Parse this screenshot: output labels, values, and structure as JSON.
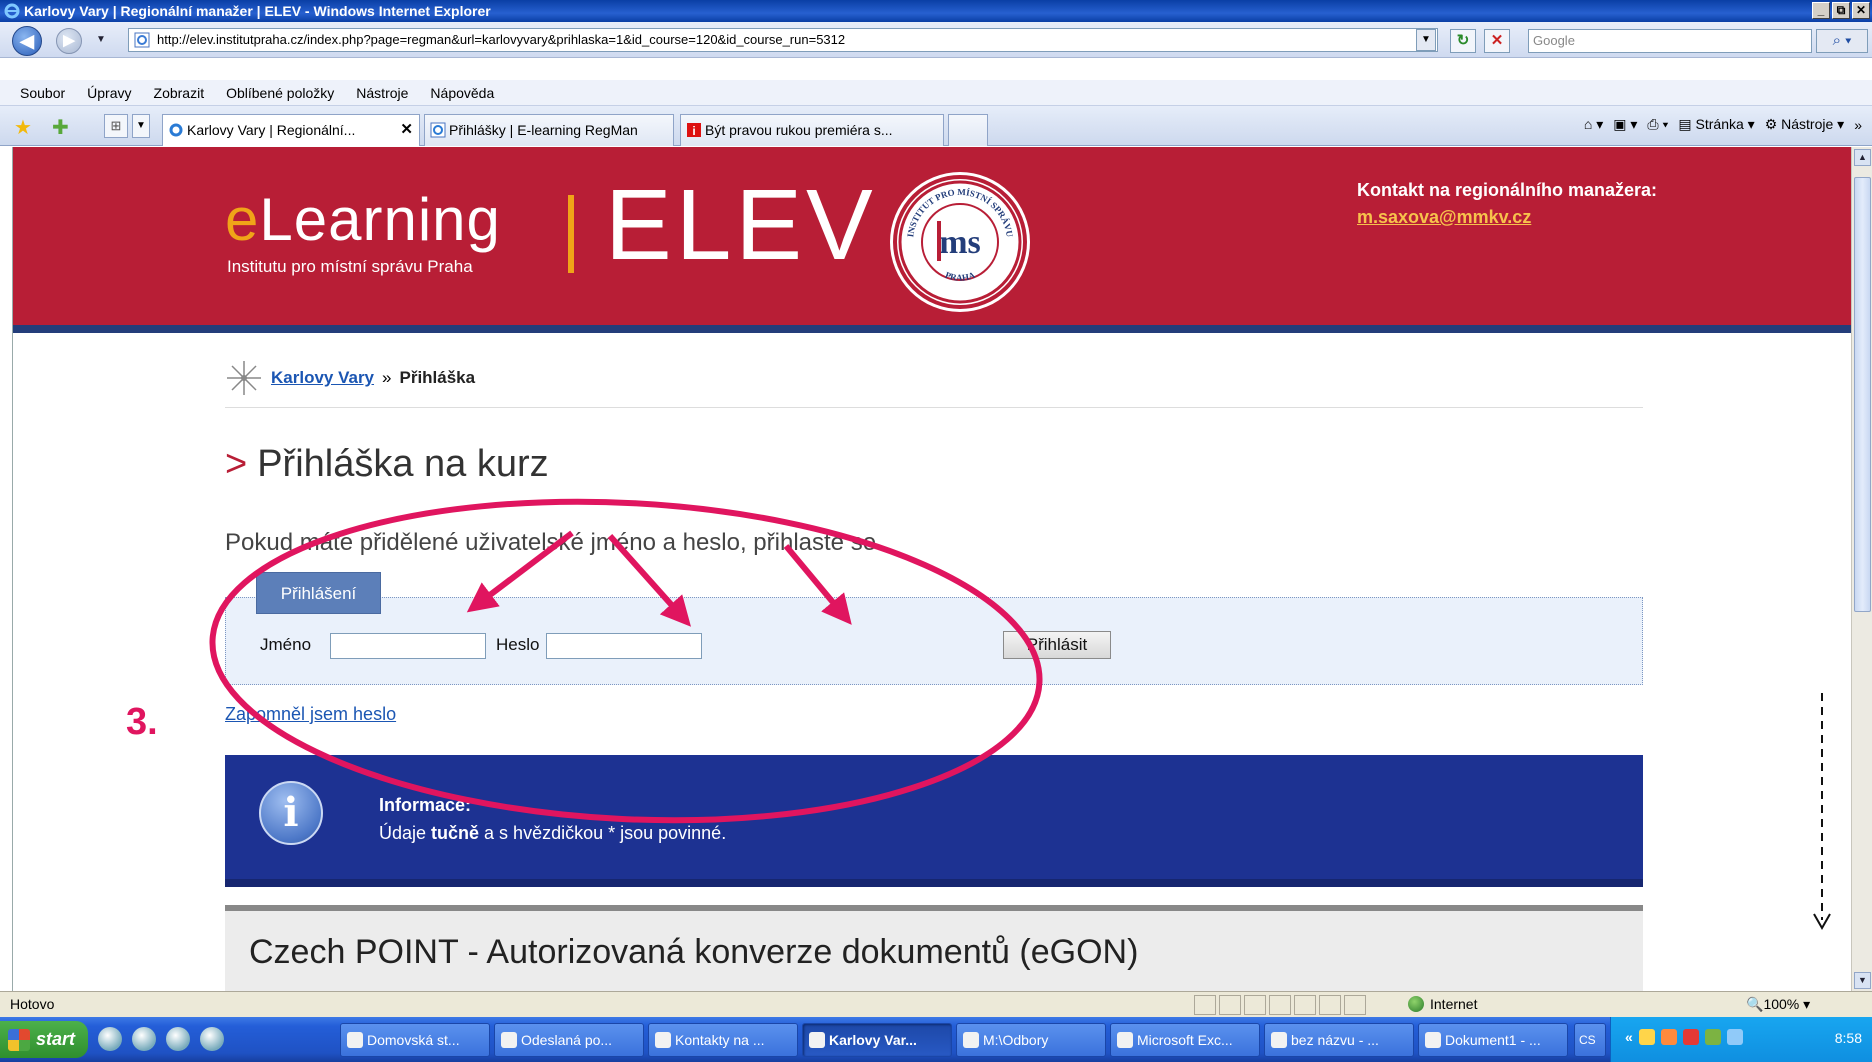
{
  "window": {
    "title": "Karlovy Vary | Regionální manažer | ELEV - Windows Internet Explorer",
    "min": "_",
    "max": "⧉",
    "close": "✕"
  },
  "address": {
    "url": "http://elev.institutpraha.cz/index.php?page=regman&url=karlovyvary&prihlaska=1&id_course=120&id_course_run=5312",
    "search_placeholder": "Google"
  },
  "menu": [
    "Soubor",
    "Úpravy",
    "Zobrazit",
    "Oblíbené položky",
    "Nástroje",
    "Nápověda"
  ],
  "tabs": [
    {
      "label": "Karlovy Vary | Regionální...",
      "active": true
    },
    {
      "label": "Přihlášky | E-learning RegMan",
      "active": false
    },
    {
      "label": "Být pravou rukou premiéra s...",
      "active": false
    }
  ],
  "commandbar": {
    "page": "Stránka",
    "tools": "Nástroje"
  },
  "site": {
    "logo_e": "e",
    "logo_rest": "Learning",
    "logo_sub": "Institutu pro místní správu Praha",
    "logo_elev": "ELEV",
    "seal_top": "INSTITUT PRO MÍSTNÍ SPRÁVU",
    "seal_bottom": "PRAHA",
    "contact_label": "Kontakt na regionálního manažera:",
    "contact_email": "m.saxova@mmkv.cz"
  },
  "breadcrumb": {
    "link": "Karlovy Vary",
    "sep": "»",
    "current": "Přihláška"
  },
  "page": {
    "title_marker": ">",
    "title": "Přihláška na kurz",
    "hint": "Pokud máte přidělené uživatelské jméno a heslo, přihlaste se."
  },
  "login": {
    "tab": "Přihlášení",
    "name_label": "Jméno",
    "password_label": "Heslo",
    "button": "Přihlásit",
    "name_value": "",
    "password_value": ""
  },
  "forgot": "Zapomněl jsem heslo",
  "info": {
    "icon": "i",
    "title": "Informace:",
    "text_pre": "Údaje ",
    "text_bold": "tučně",
    "text_post": " a s hvězdičkou * jsou povinné."
  },
  "course_title": "Czech POINT - Autorizovaná konverze dokumentů (eGON)",
  "annotation": {
    "step": "3.",
    "color": "#e0155f"
  },
  "status": {
    "text": "Hotovo",
    "zone": "Internet",
    "zoom": "100%"
  },
  "taskbar": {
    "start": "start",
    "buttons": [
      "Domovská st...",
      "Odeslaná po...",
      "Kontakty na ...",
      "Karlovy Var...",
      "M:\\Odbory",
      "Microsoft Exc...",
      "bez názvu - ...",
      "Dokument1 - ..."
    ],
    "lang": "CS",
    "clock": "8:58"
  }
}
